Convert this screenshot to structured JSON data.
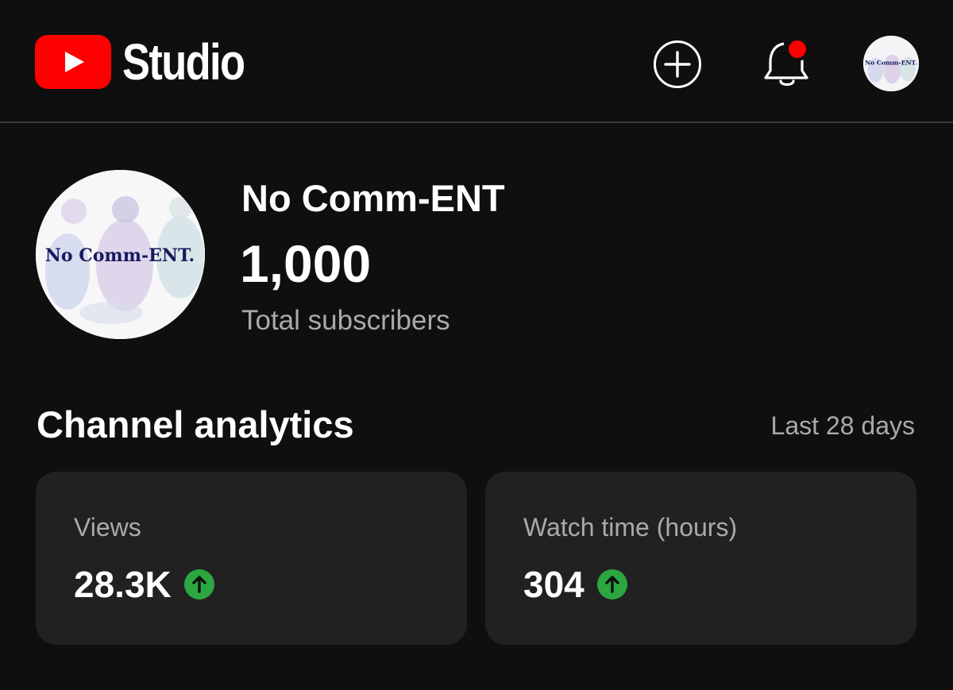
{
  "header": {
    "logo_text": "Studio",
    "icons": {
      "logo": "youtube-play-icon",
      "create": "plus-circle-icon",
      "notifications": "bell-icon",
      "account": "channel-avatar"
    },
    "notification_dot": true,
    "avatar_text": "No Comm-ENT."
  },
  "channel": {
    "name": "No Comm-ENT",
    "avatar_text": "No Comm-ENT.",
    "subscriber_count": "1,000",
    "subscriber_label": "Total subscribers"
  },
  "analytics": {
    "title": "Channel analytics",
    "period": "Last 28 days",
    "cards": [
      {
        "label": "Views",
        "value": "28.3K",
        "trend": "up"
      },
      {
        "label": "Watch time (hours)",
        "value": "304",
        "trend": "up"
      }
    ]
  },
  "colors": {
    "background": "#0f0f0f",
    "card": "#212121",
    "brand_red": "#ff0000",
    "notification_red": "#ff0000",
    "trend_up_green": "#2ba640",
    "secondary_text": "#aaaaaa",
    "avatar_text": "#1a1a5e"
  }
}
